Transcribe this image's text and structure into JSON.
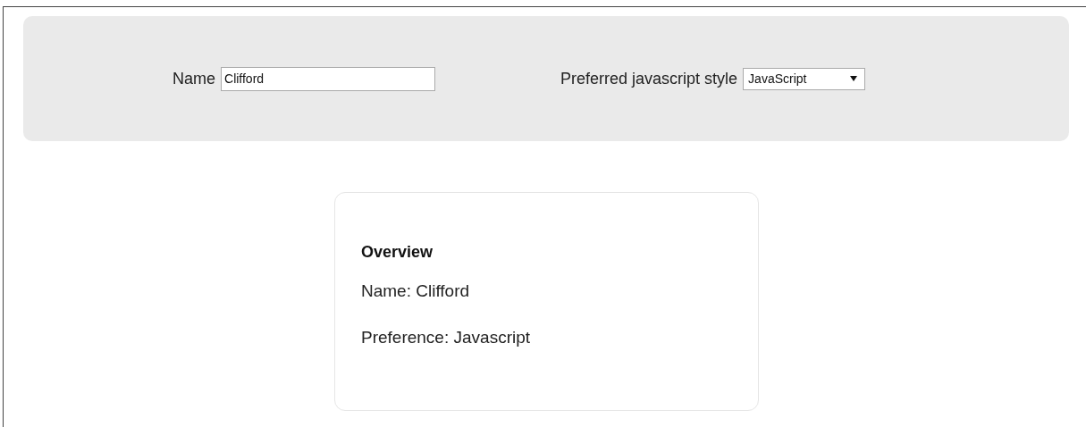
{
  "form": {
    "name_field": {
      "label": "Name",
      "value": "Clifford"
    },
    "style_select": {
      "label": "Preferred javascript style",
      "value": "JavaScript"
    }
  },
  "overview": {
    "title": "Overview",
    "lines": [
      "Name: Clifford",
      "Preference: Javascript"
    ]
  }
}
